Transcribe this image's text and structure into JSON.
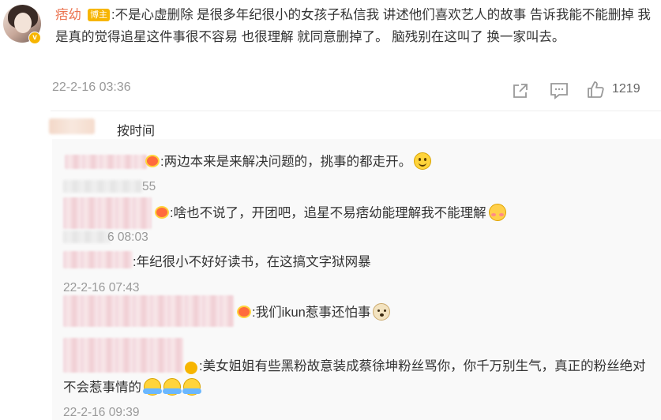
{
  "post": {
    "username": "痞幼",
    "role_tag": "博主",
    "text": ":不是心虚删除 是很多年纪很小的女孩子私信我 讲述他们喜欢艺人的故事 告诉我能不能删掉 我是真的觉得追星这件事很不容易 也很理解 就同意删掉了。 脑残别在这叫了 换一家叫去。",
    "time": "22-2-16 03:36",
    "like_count": "1219"
  },
  "sort": {
    "label": "按时间"
  },
  "comments": [
    {
      "text": ":两边本来是来解决问题的，挑事的都走开。",
      "time_suffix": "55",
      "emoji": "smile-emoji"
    },
    {
      "text": ":啥也不说了，开团吧，追星不易痞幼能理解我不能理解",
      "time_suffix": "6 08:03",
      "emoji": "shy-emoji"
    },
    {
      "text": ":年纪很小不好好读书，在这搞文字狱网暴",
      "time": "22-2-16 07:43"
    },
    {
      "text": ":我们ikun惹事还怕事",
      "emoji": "dog-emoji"
    },
    {
      "text": ":美女姐姐有些黑粉故意装成蔡徐坤粉丝骂你，你千万别生气，真正的粉丝绝对不会惹事情的",
      "time": "22-2-16 09:39",
      "emoji": "hug-emoji"
    }
  ],
  "icons": [
    "share-icon",
    "comment-icon",
    "like-icon",
    "verified-icon"
  ],
  "colors": {
    "username": "#eb7350",
    "role_tag": "#f7b500",
    "time": "#999999"
  }
}
